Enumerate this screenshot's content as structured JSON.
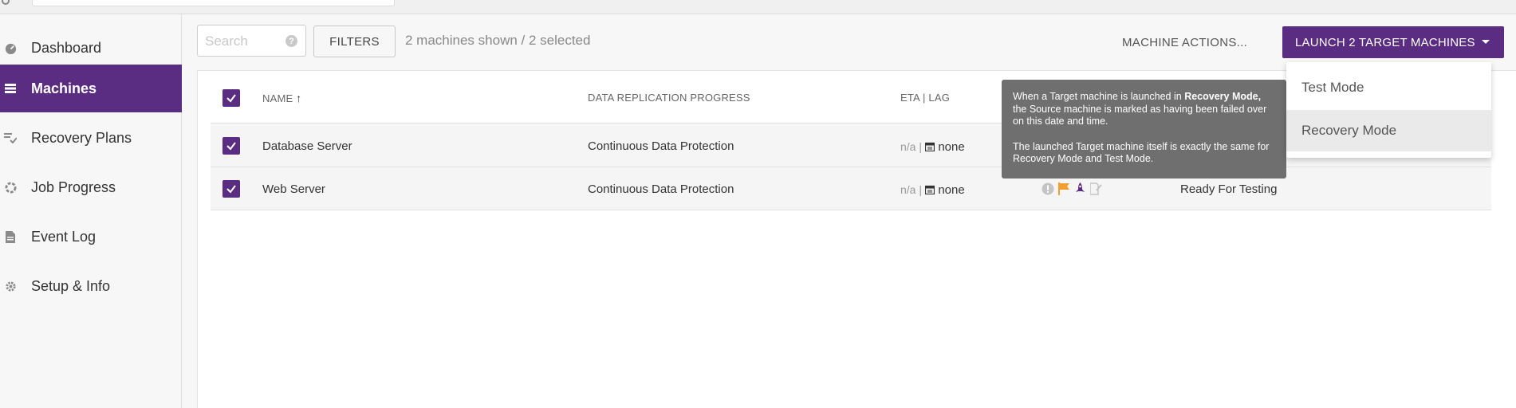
{
  "sidebar": {
    "items": [
      {
        "label": "Dashboard",
        "icon": "dashboard-icon"
      },
      {
        "label": "Machines",
        "icon": "machines-icon",
        "active": true
      },
      {
        "label": "Recovery Plans",
        "icon": "recovery-plans-icon"
      },
      {
        "label": "Job Progress",
        "icon": "job-progress-icon"
      },
      {
        "label": "Event Log",
        "icon": "event-log-icon"
      },
      {
        "label": "Setup & Info",
        "icon": "gear-icon"
      }
    ]
  },
  "toolbar": {
    "search_placeholder": "Search",
    "filters_label": "FILTERS",
    "summary": "2 machines shown / 2 selected",
    "machine_actions": "MACHINE ACTIONS...",
    "launch_label": "LAUNCH 2 TARGET MACHINES"
  },
  "table": {
    "headers": {
      "name": "NAME",
      "progress": "DATA REPLICATION PROGRESS",
      "eta": "ETA | LAG"
    },
    "rows": [
      {
        "name": "Database Server",
        "progress": "Continuous Data Protection",
        "eta": "n/a |",
        "lag": "none",
        "status": ""
      },
      {
        "name": "Web Server",
        "progress": "Continuous Data Protection",
        "eta": "n/a |",
        "lag": "none",
        "status": "Ready For Testing"
      }
    ]
  },
  "tooltip": {
    "p1_a": "When a Target machine is launched in ",
    "p1_bold": "Recovery Mode,",
    "p1_b": " the Source machine is marked as having been failed over on this date and time.",
    "p2": "The launched Target machine itself is exactly the same for Recovery Mode and Test Mode."
  },
  "dropdown": {
    "items": [
      "Test Mode",
      "Recovery Mode"
    ]
  },
  "colors": {
    "accent": "#5b2d82",
    "flag": "#f0a030",
    "tooltip_bg": "#6f6f6f"
  }
}
